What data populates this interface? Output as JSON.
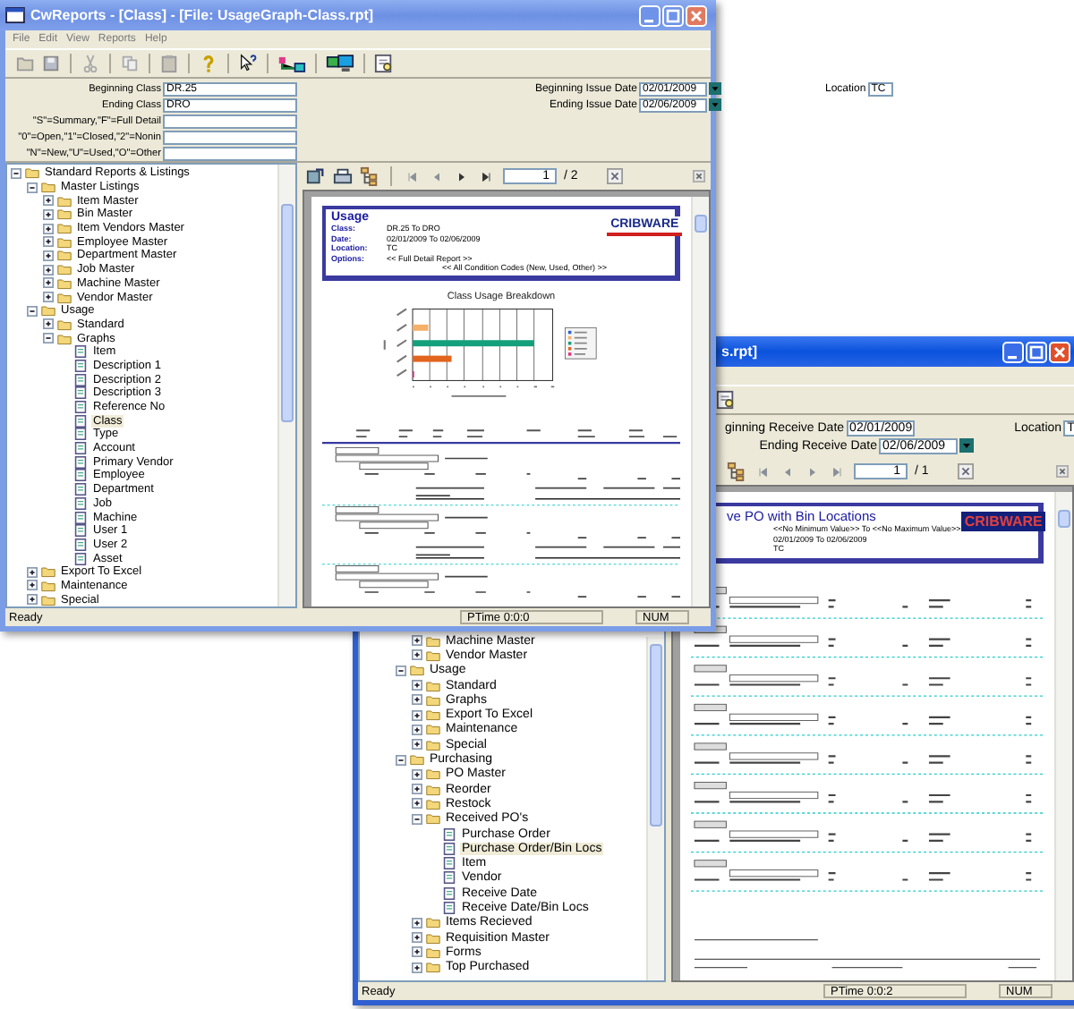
{
  "back_window": {
    "title": "s.rpt]",
    "params": [
      {
        "label": "ginning Receive Date",
        "value": "02/01/2009"
      },
      {
        "label": "Ending Receive Date",
        "value": "02/06/2009"
      }
    ],
    "location": {
      "label": "Location",
      "value": "T"
    },
    "report_toolbar": {
      "page": "1",
      "total": "/ 1"
    },
    "report": {
      "title": "ve PO with Bin Locations",
      "values": [
        "<<No Minimum Value>> To <<No Maximum Value>>",
        "02/01/2009 To 02/06/2009",
        "TC"
      ],
      "logo": "CRIBWARE"
    },
    "tree": [
      {
        "children": [
          {
            "children": [
              {
                "label": "Machine Master",
                "kind": "folder",
                "expanded": false,
                "selected": false
              },
              {
                "label": "Vendor Master",
                "kind": "folder",
                "expanded": false,
                "selected": false
              }
            ]
          },
          {
            "label": "Usage",
            "kind": "folder",
            "expanded": true,
            "selected": false,
            "children": [
              {
                "label": "Standard",
                "kind": "folder",
                "expanded": false,
                "selected": false
              },
              {
                "label": "Graphs",
                "kind": "folder",
                "expanded": false,
                "selected": false
              },
              {
                "label": "Export To Excel",
                "kind": "folder",
                "expanded": false,
                "selected": false
              },
              {
                "label": "Maintenance",
                "kind": "folder",
                "expanded": false,
                "selected": false
              },
              {
                "label": "Special",
                "kind": "folder",
                "expanded": false,
                "selected": false
              }
            ]
          },
          {
            "label": "Purchasing",
            "kind": "folder",
            "expanded": true,
            "selected": false,
            "children": [
              {
                "label": "PO Master",
                "kind": "folder",
                "expanded": false,
                "selected": false
              },
              {
                "label": "Reorder",
                "kind": "folder",
                "expanded": false,
                "selected": false
              },
              {
                "label": "Restock",
                "kind": "folder",
                "expanded": false,
                "selected": false
              },
              {
                "label": "Received PO's",
                "kind": "folder",
                "expanded": true,
                "selected": false,
                "children": [
                  {
                    "label": "Purchase Order",
                    "kind": "report",
                    "selected": false
                  },
                  {
                    "label": "Purchase Order/Bin Locs",
                    "kind": "report",
                    "selected": true
                  },
                  {
                    "label": "Item",
                    "kind": "report",
                    "selected": false
                  },
                  {
                    "label": "Vendor",
                    "kind": "report",
                    "selected": false
                  },
                  {
                    "label": "Receive Date",
                    "kind": "report",
                    "selected": false
                  },
                  {
                    "label": "Receive Date/Bin Locs",
                    "kind": "report",
                    "selected": false
                  }
                ]
              },
              {
                "label": "Items Recieved",
                "kind": "folder",
                "expanded": false,
                "selected": false
              },
              {
                "label": "Requisition Master",
                "kind": "folder",
                "expanded": false,
                "selected": false
              },
              {
                "label": "Forms",
                "kind": "folder",
                "expanded": false,
                "selected": false
              },
              {
                "label": "Top Purchased",
                "kind": "folder",
                "expanded": false,
                "selected": false
              }
            ]
          }
        ]
      }
    ],
    "status_bar": {
      "message": "Ready",
      "ptime": "PTime 0:0:2",
      "num": "NUM"
    }
  },
  "front_window": {
    "title": "CwReports - [Class] - [File: UsageGraph-Class.rpt]",
    "menu": [
      "File",
      "Edit",
      "View",
      "Reports",
      "Help"
    ],
    "params_left": [
      {
        "label": "Beginning Class",
        "value": "DR.25"
      },
      {
        "label": "Ending Class",
        "value": "DRO"
      },
      {
        "label": "\"S\"=Summary,\"F\"=Full Detail"
      },
      {
        "label": "\"0\"=Open,\"1\"=Closed,\"2\"=Nonin"
      },
      {
        "label": "\"N\"=New,\"U\"=Used,\"O\"=Other"
      }
    ],
    "params_right": [
      {
        "label": "Beginning Issue Date",
        "value": "02/01/2009"
      },
      {
        "label": "Ending Issue Date",
        "value": "02/06/2009"
      }
    ],
    "location": {
      "label": "Location",
      "value": "TC"
    },
    "tree": [
      {
        "label": "Standard Reports & Listings",
        "kind": "folder",
        "expanded": true,
        "selected": false,
        "children": [
          {
            "label": "Master Listings",
            "kind": "folder",
            "expanded": true,
            "selected": false,
            "children": [
              {
                "label": "Item Master",
                "kind": "folder",
                "expanded": false,
                "selected": false
              },
              {
                "label": "Bin Master",
                "kind": "folder",
                "expanded": false,
                "selected": false
              },
              {
                "label": "Item Vendors Master",
                "kind": "folder",
                "expanded": false,
                "selected": false
              },
              {
                "label": "Employee Master",
                "kind": "folder",
                "expanded": false,
                "selected": false
              },
              {
                "label": "Department Master",
                "kind": "folder",
                "expanded": false,
                "selected": false
              },
              {
                "label": "Job Master",
                "kind": "folder",
                "expanded": false,
                "selected": false
              },
              {
                "label": "Machine Master",
                "kind": "folder",
                "expanded": false,
                "selected": false
              },
              {
                "label": "Vendor Master",
                "kind": "folder",
                "expanded": false,
                "selected": false
              }
            ]
          },
          {
            "label": "Usage",
            "kind": "folder",
            "expanded": true,
            "selected": false,
            "children": [
              {
                "label": "Standard",
                "kind": "folder",
                "expanded": false,
                "selected": false
              },
              {
                "label": "Graphs",
                "kind": "folder",
                "expanded": true,
                "selected": false,
                "children": [
                  {
                    "label": "Item",
                    "kind": "report",
                    "selected": false
                  },
                  {
                    "label": "Description 1",
                    "kind": "report",
                    "selected": false
                  },
                  {
                    "label": "Description 2",
                    "kind": "report",
                    "selected": false
                  },
                  {
                    "label": "Description 3",
                    "kind": "report",
                    "selected": false
                  },
                  {
                    "label": "Reference No",
                    "kind": "report",
                    "selected": false
                  },
                  {
                    "label": "Class",
                    "kind": "report",
                    "selected": true
                  },
                  {
                    "label": "Type",
                    "kind": "report",
                    "selected": false
                  },
                  {
                    "label": "Account",
                    "kind": "report",
                    "selected": false
                  },
                  {
                    "label": "Primary Vendor",
                    "kind": "report",
                    "selected": false
                  },
                  {
                    "label": "Employee",
                    "kind": "report",
                    "selected": false
                  },
                  {
                    "label": "Department",
                    "kind": "report",
                    "selected": false
                  },
                  {
                    "label": "Job",
                    "kind": "report",
                    "selected": false
                  },
                  {
                    "label": "Machine",
                    "kind": "report",
                    "selected": false
                  },
                  {
                    "label": "User 1",
                    "kind": "report",
                    "selected": false
                  },
                  {
                    "label": "User 2",
                    "kind": "report",
                    "selected": false
                  },
                  {
                    "label": "Asset",
                    "kind": "report",
                    "selected": false
                  }
                ]
              }
            ]
          },
          {
            "label": "Export To Excel",
            "kind": "folder",
            "expanded": false,
            "selected": false
          },
          {
            "label": "Maintenance",
            "kind": "folder",
            "expanded": false,
            "selected": false
          },
          {
            "label": "Special",
            "kind": "folder",
            "expanded": false,
            "selected": false
          }
        ]
      }
    ],
    "report_toolbar": {
      "page": "1",
      "total": "/ 2"
    },
    "report": {
      "title": "Usage",
      "fields": [
        {
          "label": "Class:",
          "value": "DR.25 To DRO"
        },
        {
          "label": "Date:",
          "value": "02/01/2009 To 02/06/2009"
        },
        {
          "label": "Location:",
          "value": "TC"
        },
        {
          "label": "Options:",
          "value": "<< Full Detail Report >>"
        },
        {
          "value": "<< All Condition Codes (New, Used, Other) >>"
        }
      ],
      "logo": "CRIBWARE",
      "chart_title": "Class Usage Breakdown"
    },
    "status_bar": {
      "message": "Ready",
      "ptime": "PTime 0:0:0",
      "num": "NUM"
    }
  }
}
